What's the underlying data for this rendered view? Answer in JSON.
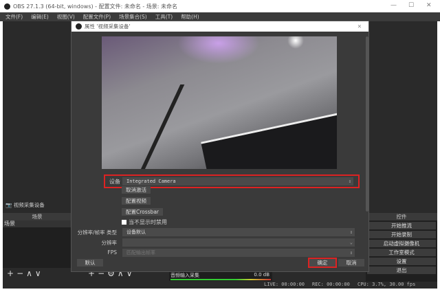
{
  "window": {
    "title": "OBS 27.1.3 (64-bit, windows) - 配置文件: 未命名 - 场景: 未命名",
    "min": "—",
    "max": "☐",
    "close": "✕"
  },
  "menu": [
    "文件(F)",
    "编辑(E)",
    "视图(V)",
    "配置文件(P)",
    "场景集合(S)",
    "工具(T)",
    "帮助(H)"
  ],
  "source_label": "视频采集设备",
  "scenes": {
    "header": "场景",
    "items": [
      "场景"
    ]
  },
  "controls": {
    "header": "控件",
    "buttons": [
      "开始推流",
      "开始录制",
      "启动虚拟摄像机",
      "工作室模式",
      "设置",
      "退出"
    ]
  },
  "toolbar": {
    "add": "+",
    "remove": "−",
    "up": "∧",
    "down": "∨"
  },
  "mixer": {
    "name": "音频输入采集",
    "level": "0.0 dB"
  },
  "status": {
    "live": "LIVE: 00:00:00",
    "rec": "REC: 00:00:00",
    "cpu": "CPU: 3.7%, 30.00 fps"
  },
  "dialog": {
    "title": "属性 '视频采集设备'",
    "device_label": "设备",
    "device_value": "Integrated Camera",
    "deactivate": "取消激活",
    "config_video": "配置视频",
    "config_crossbar": "配置Crossbar",
    "hide_checkbox": "当不显示时禁用",
    "res_type_label": "分辨率/帧率 类型",
    "res_type_value": "设备默认",
    "res_label": "分辨率",
    "res_value": "",
    "fps_label": "FPS",
    "fps_value": "匹配输出帧率",
    "defaults": "默认",
    "ok": "确定",
    "cancel": "取消"
  }
}
